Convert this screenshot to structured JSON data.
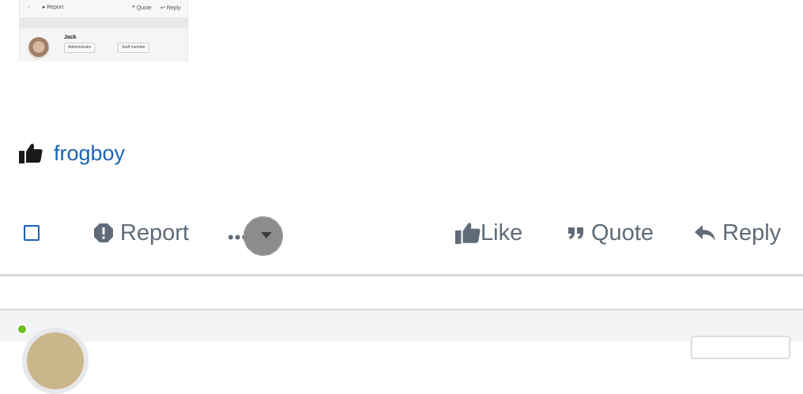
{
  "thumbnail": {
    "bar_left": "Report",
    "bar_quote": "Quote",
    "bar_reply": "Reply",
    "username": "Jack",
    "badges": [
      "Administrator",
      "Staff member"
    ]
  },
  "reaction": {
    "icon": "thumbs-up-icon",
    "user": "frogboy"
  },
  "actions": {
    "report": "Report",
    "more": "•••",
    "like": "Like",
    "quote": "Quote",
    "reply": "Reply"
  },
  "colors": {
    "link": "#1b63b7",
    "action_text": "#5f6b78",
    "checkbox": "#1c5fb0",
    "online": "#6cbf1e"
  }
}
